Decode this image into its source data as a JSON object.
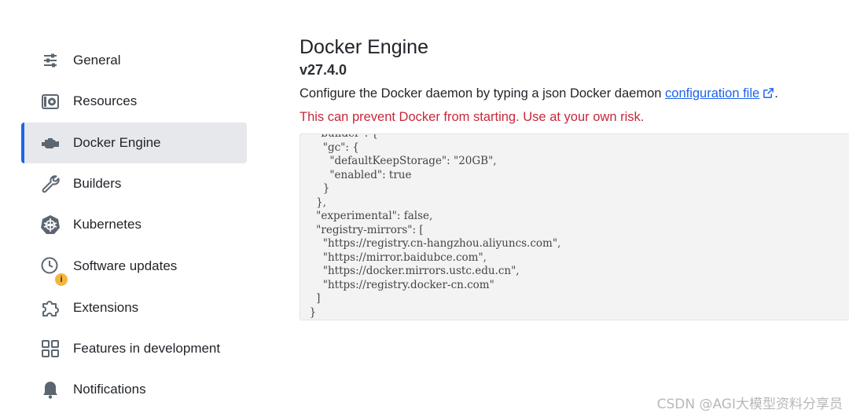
{
  "sidebar": {
    "items": [
      {
        "label": "General",
        "icon": "sliders-icon"
      },
      {
        "label": "Resources",
        "icon": "resources-icon"
      },
      {
        "label": "Docker Engine",
        "icon": "engine-icon",
        "active": true
      },
      {
        "label": "Builders",
        "icon": "wrench-icon"
      },
      {
        "label": "Kubernetes",
        "icon": "kubernetes-icon"
      },
      {
        "label": "Software updates",
        "icon": "clock-icon",
        "badge": "i"
      },
      {
        "label": "Extensions",
        "icon": "puzzle-icon"
      },
      {
        "label": "Features in development",
        "icon": "grid-icon"
      },
      {
        "label": "Notifications",
        "icon": "bell-icon"
      }
    ]
  },
  "main": {
    "title": "Docker Engine",
    "version": "v27.4.0",
    "description_prefix": "Configure the Docker daemon by typing a json Docker daemon",
    "description_link": "configuration file",
    "description_suffix": ".",
    "warning": "This can prevent Docker from starting. Use at your own risk.",
    "config_text": "    \"builder\": {\n      \"gc\": {\n        \"defaultKeepStorage\": \"20GB\",\n        \"enabled\": true\n      }\n    },\n    \"experimental\": false,\n    \"registry-mirrors\": [\n      \"https://registry.cn-hangzhou.aliyuncs.com\",\n      \"https://mirror.baidubce.com\",\n      \"https://docker.mirrors.ustc.edu.cn\",\n      \"https://registry.docker-cn.com\"\n    ]\n  }"
  },
  "watermark": "CSDN @AGI大模型资料分享员",
  "colors": {
    "accent": "#1d63ed",
    "warning": "#c8283a",
    "active_bg": "#e6e8eb",
    "editor_bg": "#f3f3f3"
  }
}
